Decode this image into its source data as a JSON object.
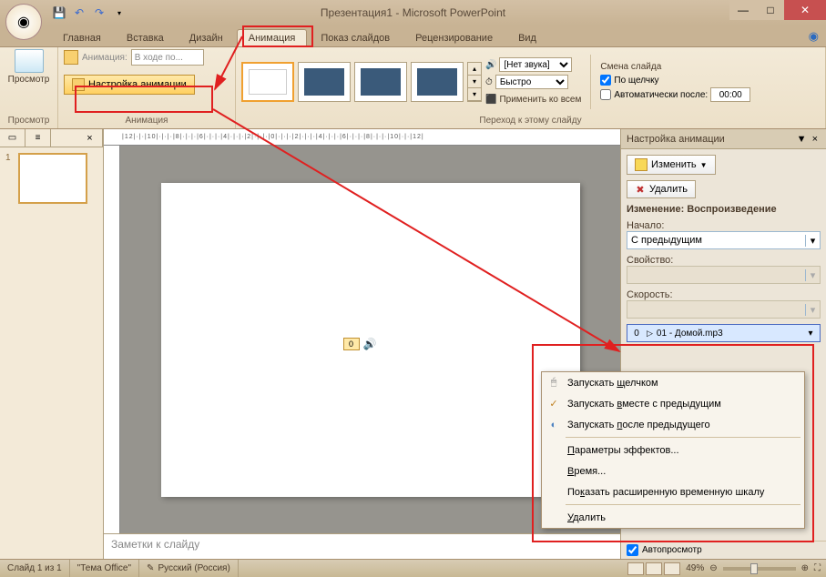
{
  "title": "Презентация1 - Microsoft PowerPoint",
  "tabs": {
    "home": "Главная",
    "insert": "Вставка",
    "design": "Дизайн",
    "animation": "Анимация",
    "slideshow": "Показ слайдов",
    "review": "Рецензирование",
    "view": "Вид"
  },
  "ribbon": {
    "preview_label": "Просмотр",
    "preview_group": "Просмотр",
    "anim_label": "Анимация:",
    "anim_combo": "В ходе по...",
    "custom_anim": "Настройка анимации",
    "anim_group": "Анимация",
    "sound_label": "[Нет звука]",
    "speed_label": "Быстро",
    "apply_all": "Применить ко всем",
    "trans_group": "Переход к этому слайду",
    "change_header": "Смена слайда",
    "on_click": "По щелчку",
    "auto_after": "Автоматически после:",
    "auto_time": "00:00"
  },
  "thumbnail": {
    "num": "1"
  },
  "slide_media": {
    "badge": "0"
  },
  "notes_placeholder": "Заметки к слайду",
  "right_pane": {
    "title": "Настройка анимации",
    "change_btn": "Изменить",
    "delete_btn": "Удалить",
    "section": "Изменение: Воспроизведение",
    "start_label": "Начало:",
    "start_value": "С предыдущим",
    "property_label": "Свойство:",
    "speed_label": "Скорость:",
    "effect_num": "0",
    "effect_name": "01 - Домой.mp3",
    "autoplay": "Автопросмотр"
  },
  "context_menu": {
    "on_click": "Запускать щелчком",
    "with_prev": "Запускать вместе с предыдущим",
    "after_prev": "Запускать после предыдущего",
    "effect_params": "Параметры эффектов...",
    "timing": "Время...",
    "show_timeline": "Показать расширенную временную шкалу",
    "remove": "Удалить"
  },
  "statusbar": {
    "slide_count": "Слайд 1 из 1",
    "theme": "\"Тема Office\"",
    "language": "Русский (Россия)",
    "zoom": "49%"
  },
  "ruler": "|12|·|·|10|·|·|·|8|·|·|·|6|·|·|·|4|·|·|·|2|·|·|·|0|·|·|·|2|·|·|·|4|·|·|·|6|·|·|·|8|·|·|·|10|·|·|12|"
}
